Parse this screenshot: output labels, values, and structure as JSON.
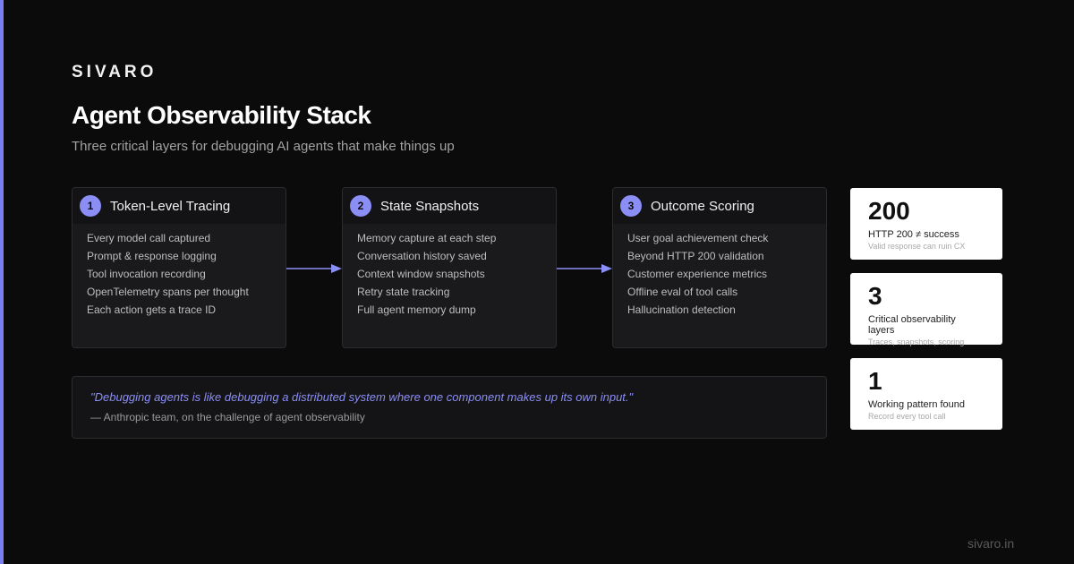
{
  "brand": "SIVARO",
  "title": "Agent Observability Stack",
  "subtitle": "Three critical layers for debugging AI agents that make things up",
  "accent_color": "#8b8ff5",
  "layers": [
    {
      "number": "1",
      "title": "Token-Level Tracing",
      "items": [
        "Every model call captured",
        "Prompt & response logging",
        "Tool invocation recording",
        "OpenTelemetry spans per thought",
        "Each action gets a trace ID"
      ]
    },
    {
      "number": "2",
      "title": "State Snapshots",
      "items": [
        "Memory capture at each step",
        "Conversation history saved",
        "Context window snapshots",
        "Retry state tracking",
        "Full agent memory dump"
      ]
    },
    {
      "number": "3",
      "title": "Outcome Scoring",
      "items": [
        "User goal achievement check",
        "Beyond HTTP 200 validation",
        "Customer experience metrics",
        "Offline eval of tool calls",
        "Hallucination detection"
      ]
    }
  ],
  "stats": [
    {
      "value": "200",
      "label": "HTTP 200 ≠ success",
      "sub": "Valid response can ruin CX"
    },
    {
      "value": "3",
      "label": "Critical observability layers",
      "sub": "Traces, snapshots, scoring"
    },
    {
      "value": "1",
      "label": "Working pattern found",
      "sub": "Record every tool call"
    }
  ],
  "quote": {
    "text": "\"Debugging agents is like debugging a distributed system where one component makes up its own input.\"",
    "attribution": "— Anthropic team, on the challenge of agent observability"
  },
  "footer_url": "sivaro.in"
}
